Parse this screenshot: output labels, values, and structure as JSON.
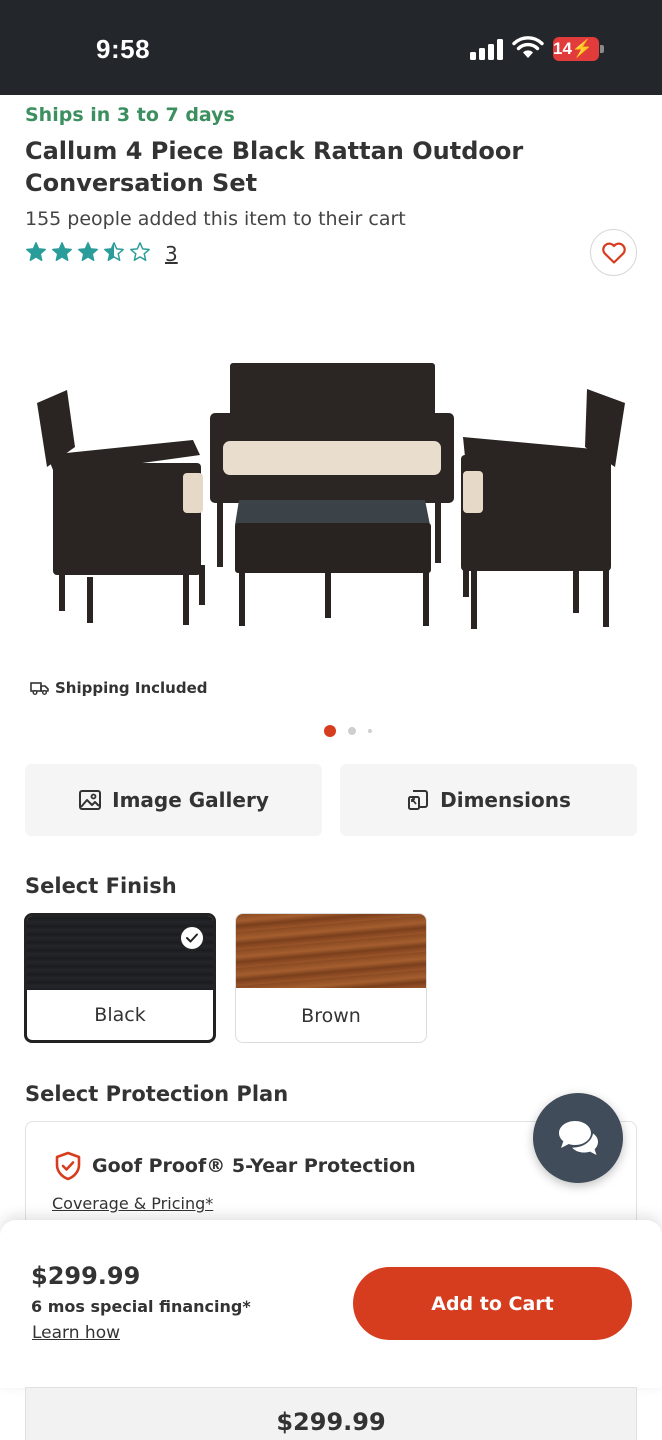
{
  "status_bar": {
    "time": "9:58",
    "battery": "14"
  },
  "product": {
    "ships_label": "Ships in 3 to 7 days",
    "title": "Callum 4 Piece Black Rattan Outdoor Conversation Set",
    "added_to_cart": "155 people added this item to their cart",
    "rating_value": 3.5,
    "rating_max": 5,
    "review_count": "3",
    "shipping_badge": "Shipping Included",
    "image_carousel": {
      "total": 3,
      "active_index": 0
    }
  },
  "actions": {
    "gallery_label": "Image Gallery",
    "dimensions_label": "Dimensions"
  },
  "finish": {
    "heading": "Select Finish",
    "options": [
      {
        "label": "Black",
        "selected": true
      },
      {
        "label": "Brown",
        "selected": false
      }
    ]
  },
  "protection": {
    "heading": "Select Protection Plan",
    "plan_name": "Goof Proof® 5-Year Protection",
    "coverage_link": "Coverage & Pricing*"
  },
  "cart_bar": {
    "price": "$299.99",
    "financing": "6 mos special financing*",
    "learn_link": "Learn how",
    "add_button": "Add to Cart"
  },
  "bottom_strip": {
    "price": "$299.99"
  },
  "colors": {
    "accent_red": "#d63d1e",
    "ships_green": "#3c8f5f",
    "star_teal": "#2a9d9a",
    "status_bar": "#23262a",
    "chat_button": "#414c5a"
  },
  "icons": [
    "signal-icon",
    "wifi-icon",
    "battery-icon",
    "heart-icon",
    "truck-icon",
    "image-icon",
    "dimensions-icon",
    "check-icon",
    "shield-icon",
    "chat-icon"
  ]
}
